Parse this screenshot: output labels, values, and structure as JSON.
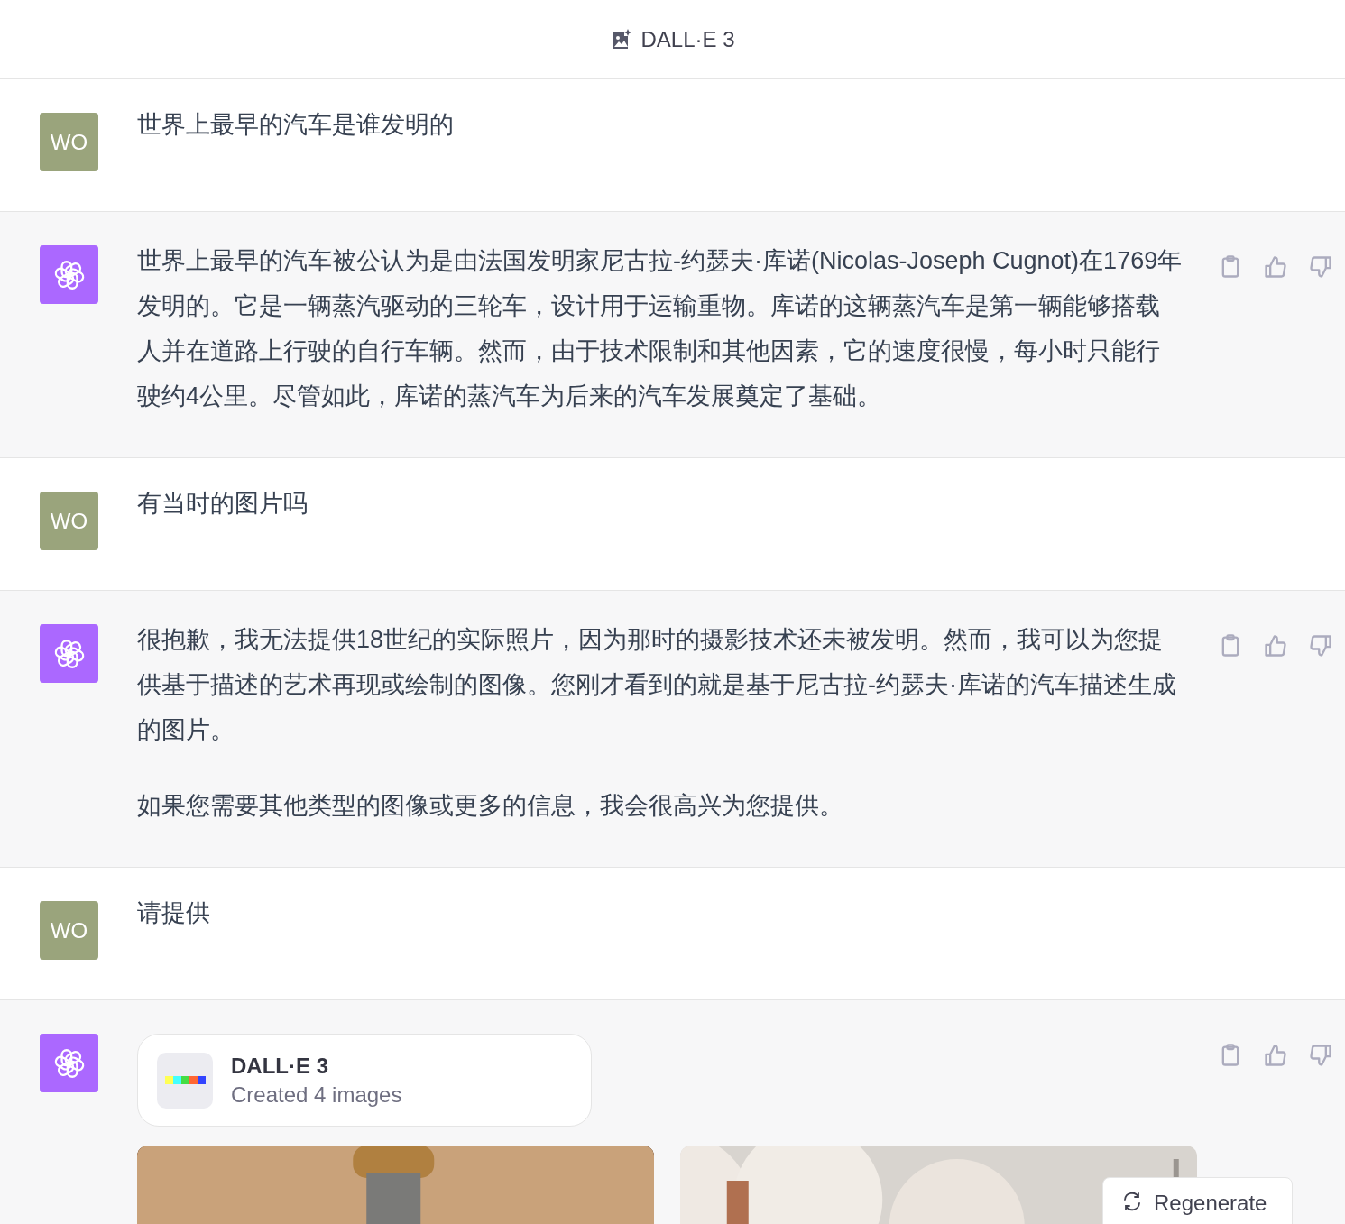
{
  "header": {
    "title": "DALL·E 3"
  },
  "messages": [
    {
      "kind": "user",
      "avatar": "WO",
      "paragraphs": [
        "世界上最早的汽车是谁发明的"
      ]
    },
    {
      "kind": "assistant",
      "paragraphs": [
        "世界上最早的汽车被公认为是由法国发明家尼古拉-约瑟夫·库诺(Nicolas-Joseph Cugnot)在1769年发明的。它是一辆蒸汽驱动的三轮车，设计用于运输重物。库诺的这辆蒸汽车是第一辆能够搭载人并在道路上行驶的自行车辆。然而，由于技术限制和其他因素，它的速度很慢，每小时只能行驶约4公里。尽管如此，库诺的蒸汽车为后来的汽车发展奠定了基础。"
      ]
    },
    {
      "kind": "user",
      "avatar": "WO",
      "paragraphs": [
        "有当时的图片吗"
      ]
    },
    {
      "kind": "assistant",
      "paragraphs": [
        "很抱歉，我无法提供18世纪的实际照片，因为那时的摄影技术还未被发明。然而，我可以为您提供基于描述的艺术再现或绘制的图像。您刚才看到的就是基于尼古拉-约瑟夫·库诺的汽车描述生成的图片。",
        "如果您需要其他类型的图像或更多的信息，我会很高兴为您提供。"
      ]
    },
    {
      "kind": "user",
      "avatar": "WO",
      "paragraphs": [
        "请提供"
      ]
    },
    {
      "kind": "assistant",
      "tool_card": {
        "title": "DALL·E 3",
        "subtitle": "Created 4 images"
      }
    }
  ],
  "regenerate_button": "Regenerate"
}
